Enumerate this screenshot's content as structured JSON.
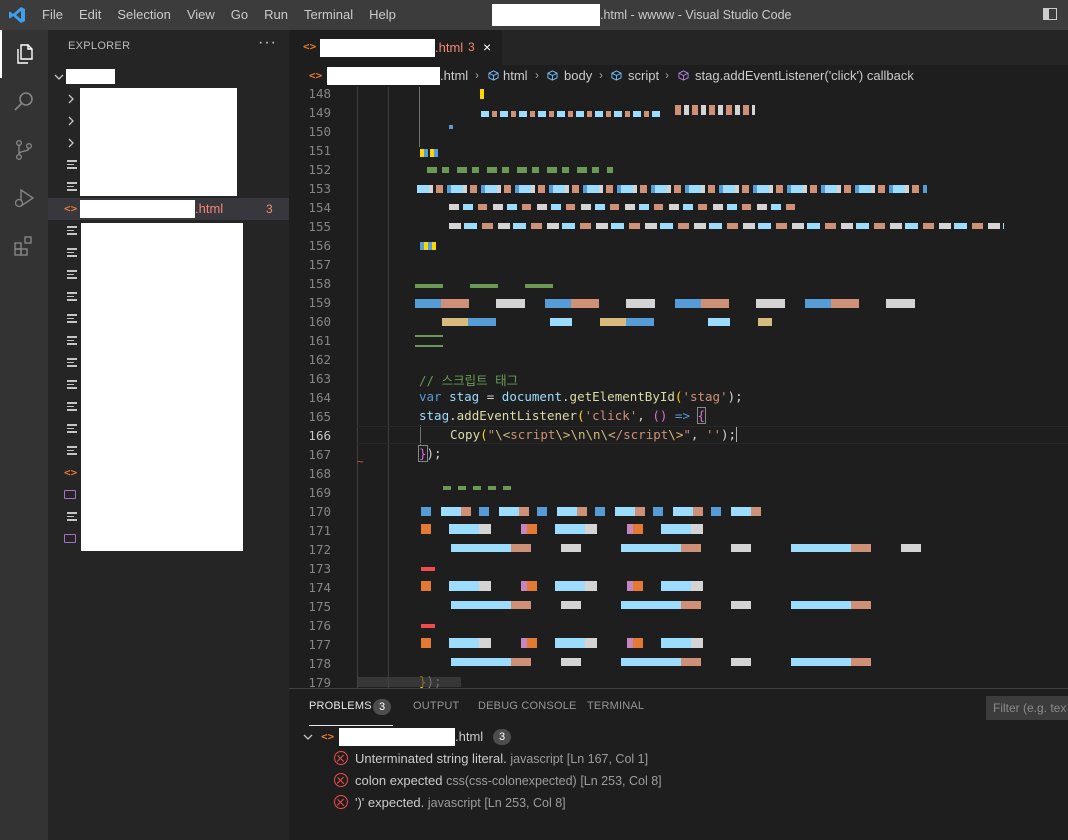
{
  "window": {
    "title_suffix": ".html - wwww - Visual Studio Code",
    "menu": [
      "File",
      "Edit",
      "Selection",
      "View",
      "Go",
      "Run",
      "Terminal",
      "Help"
    ]
  },
  "activity_bar": [
    "explorer-icon",
    "search-icon",
    "source-control-icon",
    "run-debug-icon",
    "extensions-icon"
  ],
  "sidebar": {
    "title": "EXPLORER",
    "more": "···",
    "selected_file_name": ".html",
    "selected_file_problems": "3"
  },
  "tab": {
    "name": ".html",
    "problems": "3",
    "close": "×"
  },
  "breadcrumb": {
    "file": ".html",
    "items": [
      "html",
      "body",
      "script",
      "stag.addEventListener('click') callback"
    ]
  },
  "editor": {
    "line_numbers": [
      "148",
      "149",
      "150",
      "151",
      "152",
      "153",
      "154",
      "155",
      "156",
      "157",
      "158",
      "159",
      "160",
      "161",
      "162",
      "163",
      "164",
      "165",
      "166",
      "167",
      "168",
      "169",
      "170",
      "171",
      "172",
      "173",
      "174",
      "175",
      "176",
      "177",
      "178",
      "179"
    ],
    "current_line": "166",
    "code": {
      "l163_comment": "// 스크립트 태그",
      "l164_kw": "var",
      "l164_var": "stag",
      "l164_eq": " = ",
      "l164_obj": "document",
      "l164_dot": ".",
      "l164_fn": "getElementById",
      "l164_open": "(",
      "l164_str": "'stag'",
      "l164_close": ");",
      "l165_var": "stag",
      "l165_dot": ".",
      "l165_fn": "addEventListener",
      "l165_open": "(",
      "l165_str": "'click'",
      "l165_comma": ", ",
      "l165_parens": "()",
      "l165_arrow": " => ",
      "l165_brace": "{",
      "l166_fn": "Copy",
      "l166_open": "(",
      "l166_str1": "\"",
      "l166_esc1": "\\<",
      "l166_str2": "script",
      "l166_esc2": "\\>\\n\\n\\<",
      "l166_str3": "/script",
      "l166_esc3": "\\>",
      "l166_str4": "\"",
      "l166_comma": ", ",
      "l166_str5": "''",
      "l166_close": ");",
      "l167_brace": "}",
      "l167_close": ");",
      "l179_brace": "}",
      "l179_close": ");"
    }
  },
  "panel": {
    "tabs": [
      "PROBLEMS",
      "OUTPUT",
      "DEBUG CONSOLE",
      "TERMINAL"
    ],
    "problems_count": "3",
    "filter_placeholder": "Filter (e.g. text",
    "file_name": ".html",
    "file_count": "3",
    "problems": [
      {
        "message": "Unterminated string literal.",
        "source": "javascript",
        "location": "[Ln 167, Col 1]"
      },
      {
        "message": "colon expected",
        "source": "css(css-colonexpected)",
        "location": "[Ln 253, Col 8]"
      },
      {
        "message": "')' expected.",
        "source": "javascript",
        "location": "[Ln 253, Col 8]"
      }
    ]
  },
  "colors": {
    "error": "#f14c4c",
    "problem_file": "#f48771",
    "accent": "#007acc"
  }
}
